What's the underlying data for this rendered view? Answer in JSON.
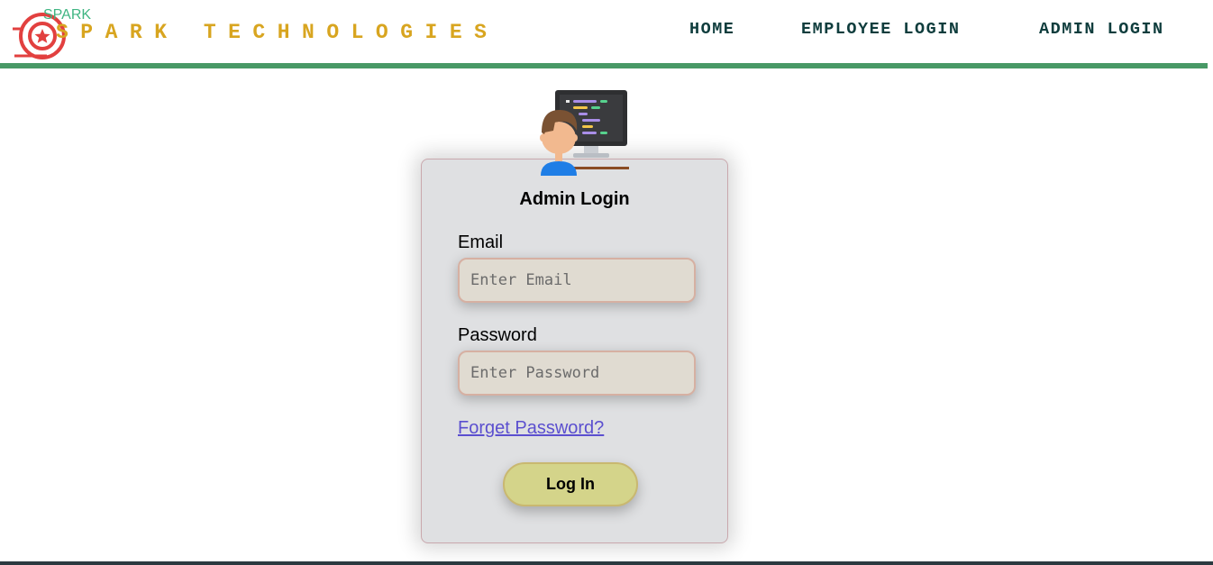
{
  "header": {
    "logo_small_text": "SPARK",
    "brand_text": "SPARK TECHNOLOGIES",
    "nav": {
      "home": "HOME",
      "employee_login": "EMPLOYEE LOGIN",
      "admin_login": "ADMIN LOGIN"
    }
  },
  "form": {
    "title": "Admin Login",
    "email_label": "Email",
    "email_placeholder": "Enter Email",
    "password_label": "Password",
    "password_placeholder": "Enter Password",
    "forgot_link": "Forget Password?",
    "submit_label": "Log In"
  },
  "colors": {
    "brand": "#d8a520",
    "nav_text": "#0f3d3d",
    "rule": "#489966",
    "card_bg": "#dfe0e2",
    "button_bg": "#d4d48a"
  }
}
